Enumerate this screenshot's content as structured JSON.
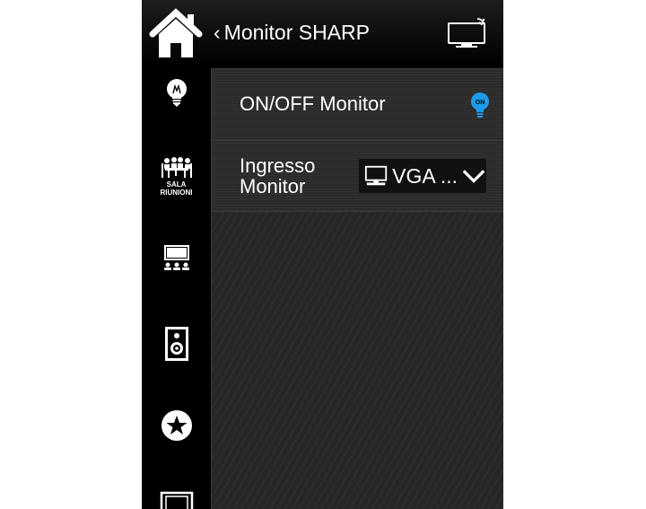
{
  "header": {
    "back_label": "Monitor SHARP",
    "back_chevron": "‹",
    "home_icon": "home-icon",
    "cast_icon": "monitor-cast-icon"
  },
  "sidebar": {
    "items": [
      {
        "icon": "lightbulb-icon",
        "caption": ""
      },
      {
        "icon": "meeting-room-icon",
        "caption_line1": "SALA",
        "caption_line2": "RIUNIONI"
      },
      {
        "icon": "conference-display-icon",
        "caption": ""
      },
      {
        "icon": "speaker-icon",
        "caption": ""
      },
      {
        "icon": "star-icon",
        "caption": ""
      },
      {
        "icon": "frame-icon",
        "caption": ""
      }
    ]
  },
  "rows": {
    "power": {
      "label": "ON/OFF Monitor",
      "toggle_text": "ON",
      "toggle_color": "#1e9be8"
    },
    "input": {
      "label": "Ingresso Monitor",
      "selected_value": "VGA ...",
      "select_icon": "monitor-icon"
    }
  },
  "colors": {
    "accent": "#1e9be8",
    "background": "#000000",
    "panel": "#262626"
  }
}
